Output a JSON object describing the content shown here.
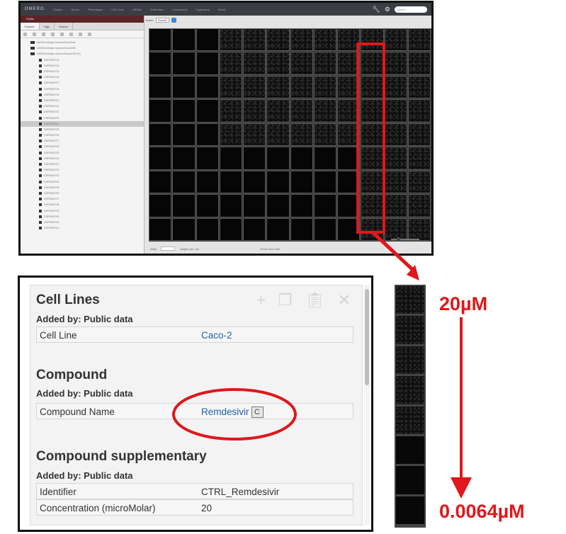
{
  "top_screenshot": {
    "app_logo": "OMERO",
    "nav_items": [
      "Studies",
      "Genes",
      "Phenotypes",
      "Cell Lines",
      "siRNAs",
      "Antibodies",
      "Compounds",
      "Organisms",
      "About"
    ],
    "search_placeholder": "Search",
    "project_header": "Public",
    "tabs": [
      "Explore",
      "Tags",
      "Shares"
    ],
    "tree_root": [
      "idr0094-ellinger-sarscov2/screenA",
      "idr0094-ellinger-sarscov2/screenB",
      "idr0094-ellinger-sarscov2/screenB [31]"
    ],
    "plates": [
      "DSP0053713",
      "DSP0053714",
      "DSP0053715",
      "DSP0053716",
      "DSP0053717",
      "DSP0053718",
      "DSP0053719",
      "DSP0053720",
      "DSP0053721",
      "DSP0053722",
      "DSP0053723",
      "DSP0053724",
      "DSP0053725",
      "DSP0053726",
      "DSP0053727",
      "DSP0053728",
      "DSP0053729",
      "DSP0053730",
      "DSP0053731",
      "DSP0053732",
      "DSP0053733",
      "DSP0053734",
      "DSP0053735",
      "DSP0053736",
      "DSP0053737",
      "DSP0053738",
      "DSP0053739",
      "DSP0053740",
      "DSP0053741",
      "DSP0053742"
    ],
    "selected_plate_index": 11,
    "field_label": "Index:",
    "field_value": "Field#1",
    "bottom_left_label": "Wrap",
    "bottom_mid_label": "Images per row",
    "bottom_right_label": "Fields from well",
    "highlighted_column": 9
  },
  "metadata_panel": {
    "sections": [
      {
        "title": "Cell Lines",
        "added_by": "Added by: Public data",
        "rows": [
          {
            "key": "Cell Line",
            "value": "Caco-2",
            "link": true
          }
        ]
      },
      {
        "title": "Compound",
        "added_by": "Added by: Public data",
        "rows": [
          {
            "key": "Compound Name",
            "value": "Remdesivir",
            "link": true,
            "badge": "C"
          }
        ]
      },
      {
        "title": "Compound supplementary",
        "added_by": "Added by: Public data",
        "rows": [
          {
            "key": "Identifier",
            "value": "CTRL_Remdesivir",
            "link": false
          },
          {
            "key": "Concentration (microMolar)",
            "value": "20",
            "link": false
          }
        ]
      }
    ],
    "toolbar_icons": [
      "plus-icon",
      "copy-icon",
      "paste-icon",
      "close-icon"
    ]
  },
  "dilution": {
    "top_label": "20µM",
    "bottom_label": "0.0064µM",
    "well_count": 8
  },
  "colors": {
    "highlight": "#e0171b",
    "link": "#2062a8",
    "header_bar": "#3a3e44",
    "project_bar": "#5b2426"
  }
}
